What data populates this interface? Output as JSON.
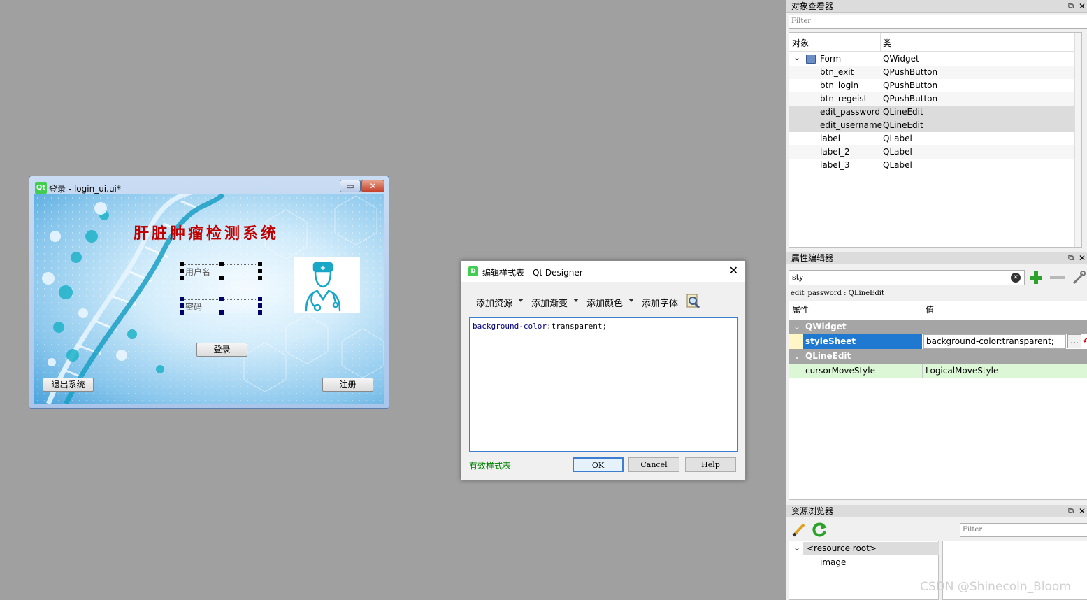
{
  "form_window": {
    "logo": "Qt",
    "title": "登录 - login_ui.ui*",
    "minimize_glyph": "▭",
    "close_glyph": "✕",
    "system_title": "肝脏肿瘤检测系统",
    "username_placeholder": "用户名",
    "password_placeholder": "密码",
    "login_label": "登录",
    "exit_label": "退出系统",
    "register_label": "注册",
    "icons": [
      "dna-helix-graphic",
      "doctor-icon"
    ]
  },
  "dialog": {
    "logo": "D",
    "title": "编辑样式表 - Qt Designer",
    "close_glyph": "✕",
    "menus": [
      "添加资源",
      "添加渐变",
      "添加颜色",
      "添加字体"
    ],
    "stylesheet_text": "background-color:transparent;",
    "code_property": "background-color",
    "code_value": "transparent;",
    "valid_text": "有效样式表",
    "ok_label": "OK",
    "cancel_label": "Cancel",
    "help_label": "Help",
    "colors": {
      "valid": "#008000",
      "keyword": "#000080"
    }
  },
  "object_inspector": {
    "title": "对象查看器",
    "float_glyph": "⧉",
    "close_glyph": "✕",
    "filter_placeholder": "Filter",
    "col_object": "对象",
    "col_class": "类",
    "rows": [
      {
        "name": "Form",
        "cls": "QWidget"
      },
      {
        "name": "btn_exit",
        "cls": "QPushButton"
      },
      {
        "name": "btn_login",
        "cls": "QPushButton"
      },
      {
        "name": "btn_regeist",
        "cls": "QPushButton"
      },
      {
        "name": "edit_password",
        "cls": "QLineEdit"
      },
      {
        "name": "edit_username",
        "cls": "QLineEdit"
      },
      {
        "name": "label",
        "cls": "QLabel"
      },
      {
        "name": "label_2",
        "cls": "QLabel"
      },
      {
        "name": "label_3",
        "cls": "QLabel"
      }
    ]
  },
  "property_editor": {
    "title": "属性编辑器",
    "float_glyph": "⧉",
    "close_glyph": "✕",
    "search_value": "sty",
    "current_object": "edit_password : QLineEdit",
    "col_property": "属性",
    "col_value": "值",
    "group_qwidget": "QWidget",
    "prop_stylesheet": "styleSheet",
    "val_stylesheet": "background-color:transparent;",
    "ellipsis": "...",
    "group_qlineedit": "QLineEdit",
    "prop_cursor": "cursorMoveStyle",
    "val_cursor": "LogicalMoveStyle"
  },
  "resource_browser": {
    "title": "资源浏览器",
    "float_glyph": "⧉",
    "close_glyph": "✕",
    "filter_placeholder": "Filter",
    "root": "<resource root>",
    "child": "image"
  },
  "watermark": "CSDN @Shinecoln_Bloom"
}
